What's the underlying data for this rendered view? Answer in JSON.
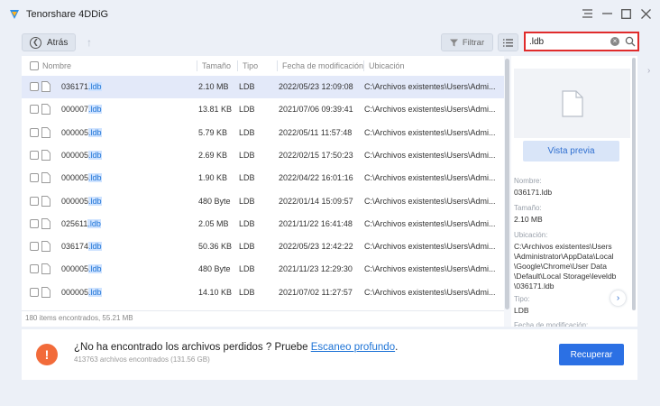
{
  "app": {
    "title": "Tenorshare 4DDiG"
  },
  "toolbar": {
    "back_label": "Atrás",
    "filter_label": "Filtrar"
  },
  "search": {
    "value": ".ldb"
  },
  "table": {
    "headers": {
      "name": "Nombre",
      "size": "Tamaño",
      "type": "Tipo",
      "date": "Fecha de modificación",
      "location": "Ubicación"
    },
    "rows": [
      {
        "name": "036171",
        "ext": ".ldb",
        "size": "2.10 MB",
        "type": "LDB",
        "date": "2022/05/23 12:09:08",
        "location": "C:\\Archivos existentes\\Users\\Admi...",
        "selected": true
      },
      {
        "name": "000007",
        "ext": ".ldb",
        "size": "13.81 KB",
        "type": "LDB",
        "date": "2021/07/06 09:39:41",
        "location": "C:\\Archivos existentes\\Users\\Admi..."
      },
      {
        "name": "000005",
        "ext": ".ldb",
        "size": "5.79 KB",
        "type": "LDB",
        "date": "2022/05/11 11:57:48",
        "location": "C:\\Archivos existentes\\Users\\Admi..."
      },
      {
        "name": "000005",
        "ext": ".ldb",
        "size": "2.69 KB",
        "type": "LDB",
        "date": "2022/02/15 17:50:23",
        "location": "C:\\Archivos existentes\\Users\\Admi..."
      },
      {
        "name": "000005",
        "ext": ".ldb",
        "size": "1.90 KB",
        "type": "LDB",
        "date": "2022/04/22 16:01:16",
        "location": "C:\\Archivos existentes\\Users\\Admi..."
      },
      {
        "name": "000005",
        "ext": ".ldb",
        "size": "480 Byte",
        "type": "LDB",
        "date": "2022/01/14 15:09:57",
        "location": "C:\\Archivos existentes\\Users\\Admi..."
      },
      {
        "name": "025611",
        "ext": ".ldb",
        "size": "2.05 MB",
        "type": "LDB",
        "date": "2021/11/22 16:41:48",
        "location": "C:\\Archivos existentes\\Users\\Admi..."
      },
      {
        "name": "036174",
        "ext": ".ldb",
        "size": "50.36 KB",
        "type": "LDB",
        "date": "2022/05/23 12:42:22",
        "location": "C:\\Archivos existentes\\Users\\Admi..."
      },
      {
        "name": "000005",
        "ext": ".ldb",
        "size": "480 Byte",
        "type": "LDB",
        "date": "2021/11/23 12:29:30",
        "location": "C:\\Archivos existentes\\Users\\Admi..."
      },
      {
        "name": "000005",
        "ext": ".ldb",
        "size": "14.10 KB",
        "type": "LDB",
        "date": "2021/07/02 11:27:57",
        "location": "C:\\Archivos existentes\\Users\\Admi..."
      }
    ],
    "footer": "180 items encontrados, 55.21 MB"
  },
  "preview": {
    "button_label": "Vista previa",
    "name_label": "Nombre:",
    "name_value": "036171.ldb",
    "size_label": "Tamaño:",
    "size_value": "2.10 MB",
    "location_label": "Ubicación:",
    "location_lines": [
      "C:\\Archivos existentes\\Users",
      "\\Administrator\\AppData\\Local",
      "\\Google\\Chrome\\User Data",
      "\\Default\\Local Storage\\leveldb",
      "\\036171.ldb"
    ],
    "type_label": "Tipo:",
    "type_value": "LDB",
    "date_label": "Fecha de modificación:"
  },
  "bottom": {
    "message_prefix": "¿No ha encontrado los archivos perdidos ? Pruebe ",
    "message_link": "Escaneo profundo",
    "message_suffix": ".",
    "sub": "413763 archivos encontrados (131.56 GB)",
    "recover_label": "Recuperar"
  },
  "colors": {
    "accent": "#2b70e4",
    "search_border": "#e02b2b",
    "warning": "#f26b3a"
  }
}
